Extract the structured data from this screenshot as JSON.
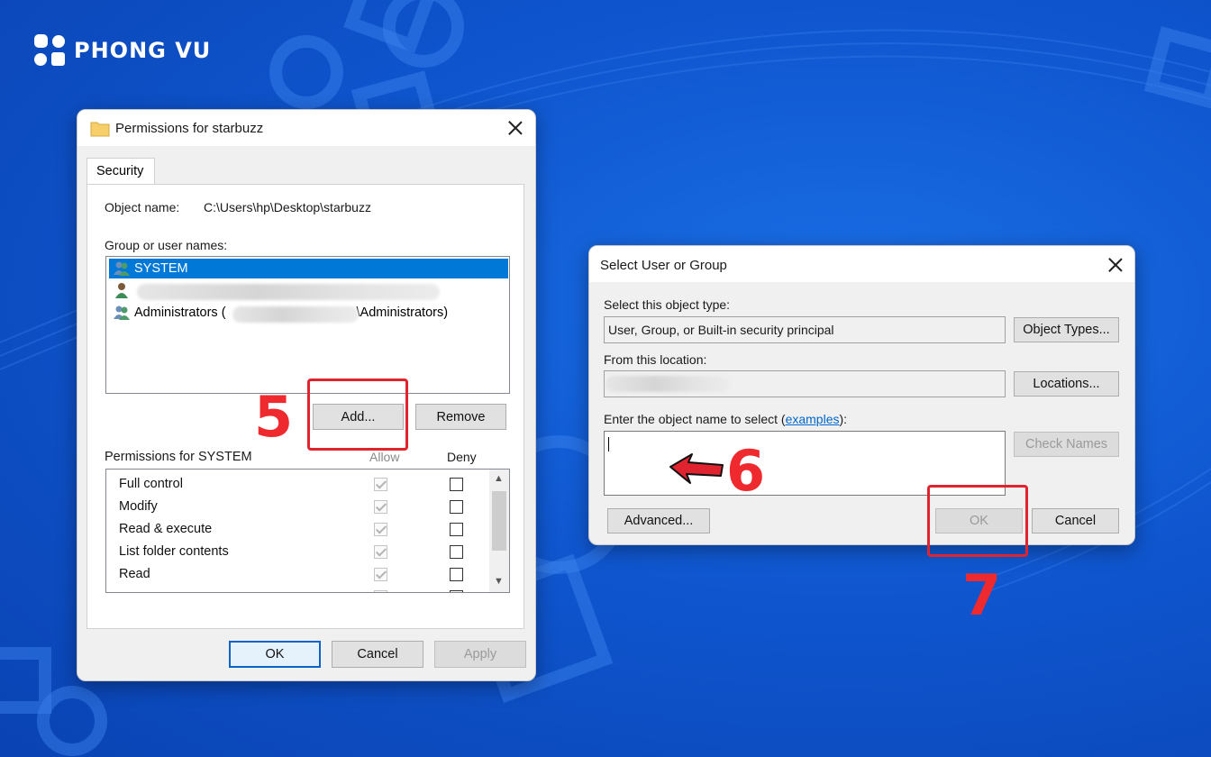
{
  "brand": {
    "name": "PHONG VU"
  },
  "colors": {
    "accent_red": "#ee2a2f",
    "selection_blue": "#0078d7",
    "link_blue": "#0066cc"
  },
  "permissions_dialog": {
    "title": "Permissions for starbuzz",
    "tab_label": "Security",
    "object_name_label": "Object name:",
    "object_name_value": "C:\\Users\\hp\\Desktop\\starbuzz",
    "group_label": "Group or user names:",
    "users": [
      {
        "name": "SYSTEM",
        "icon": "group-users-icon",
        "selected": true
      },
      {
        "name": "",
        "icon": "user-icon",
        "selected": false
      },
      {
        "name_prefix": "Administrators (",
        "name_suffix": "\\Administrators)",
        "icon": "group-users-icon",
        "selected": false
      }
    ],
    "add_button": "Add...",
    "remove_button": "Remove",
    "perms_header": "Permissions for SYSTEM",
    "allow_header": "Allow",
    "deny_header": "Deny",
    "permissions": [
      {
        "name": "Full control",
        "allow": true,
        "deny": false
      },
      {
        "name": "Modify",
        "allow": true,
        "deny": false
      },
      {
        "name": "Read & execute",
        "allow": true,
        "deny": false
      },
      {
        "name": "List folder contents",
        "allow": true,
        "deny": false
      },
      {
        "name": "Read",
        "allow": true,
        "deny": false
      }
    ],
    "ok_button": "OK",
    "cancel_button": "Cancel",
    "apply_button": "Apply"
  },
  "select_dialog": {
    "title": "Select User or Group",
    "object_type_label": "Select this object type:",
    "object_type_value": "User, Group, or Built-in security principal",
    "object_types_button": "Object Types...",
    "location_label": "From this location:",
    "locations_button": "Locations...",
    "enter_label_prefix": "Enter the object name to select (",
    "examples_link": "examples",
    "enter_label_suffix": "):",
    "object_name_value": "",
    "check_names_button": "Check Names",
    "advanced_button": "Advanced...",
    "ok_button": "OK",
    "cancel_button": "Cancel"
  },
  "annotations": {
    "step5": "5",
    "step6": "6",
    "step7": "7"
  }
}
